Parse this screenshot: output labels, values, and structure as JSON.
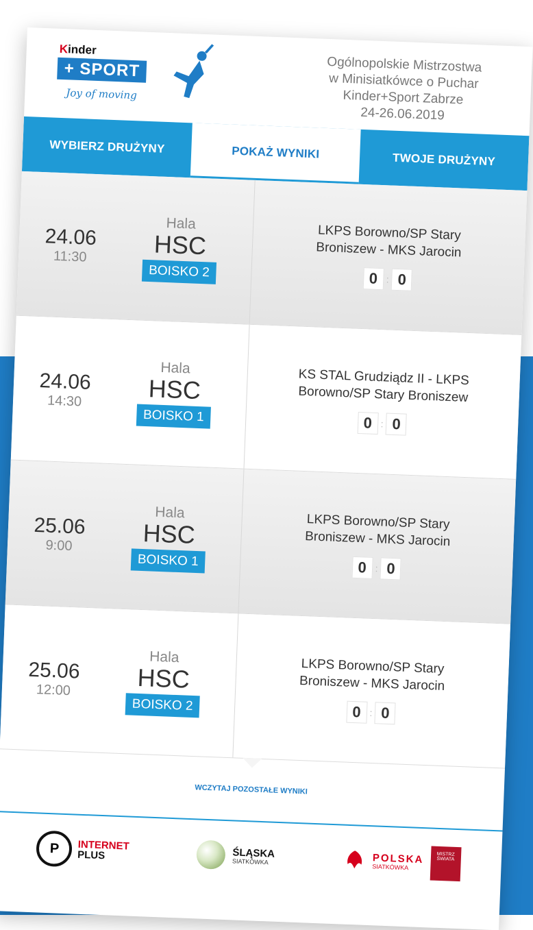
{
  "brand": {
    "kinder_prefix": "K",
    "kinder_rest": "inder",
    "sport": "+ SPORT",
    "tagline": "Joy of moving"
  },
  "event": {
    "line1": "Ogólnopolskie Mistrzostwa",
    "line2": "w Minisiatkówce o Puchar",
    "line3": "Kinder+Sport Zabrze",
    "line4": "24-26.06.2019"
  },
  "tabs": [
    {
      "label": "WYBIERZ DRUŻYNY"
    },
    {
      "label": "POKAŻ WYNIKI"
    },
    {
      "label": "TWOJE DRUŻYNY"
    }
  ],
  "matches": [
    {
      "date": "24.06",
      "time": "11:30",
      "hall_label": "Hala",
      "hall": "HSC",
      "court": "BOISKO 2",
      "teams_line1": "LKPS Borowno/SP Stary",
      "teams_line2": "Broniszew - MKS Jarocin",
      "score_home": "0",
      "score_away": "0"
    },
    {
      "date": "24.06",
      "time": "14:30",
      "hall_label": "Hala",
      "hall": "HSC",
      "court": "BOISKO 1",
      "teams_line1": "KS STAL Grudziądz II - LKPS",
      "teams_line2": "Borowno/SP Stary Broniszew",
      "score_home": "0",
      "score_away": "0"
    },
    {
      "date": "25.06",
      "time": "9:00",
      "hall_label": "Hala",
      "hall": "HSC",
      "court": "BOISKO 1",
      "teams_line1": "LKPS Borowno/SP Stary",
      "teams_line2": "Broniszew - MKS Jarocin",
      "score_home": "0",
      "score_away": "0"
    },
    {
      "date": "25.06",
      "time": "12:00",
      "hall_label": "Hala",
      "hall": "HSC",
      "court": "BOISKO 2",
      "teams_line1": "LKPS Borowno/SP Stary",
      "teams_line2": "Broniszew - MKS Jarocin",
      "score_home": "0",
      "score_away": "0"
    }
  ],
  "load_more": "WCZYTAJ POZOSTAŁE WYNIKI",
  "sponsors": {
    "internet_plus_1": "INTERNET",
    "internet_plus_2": "PLUS",
    "slaska_1": "ŚLĄSKA",
    "slaska_2": "SIATKÓWKA",
    "polska_1": "POLSKA",
    "polska_2": "SIATKÓWKA",
    "champ": "MISTRZ ŚWIATA"
  },
  "colors": {
    "primary": "#1f9ad6",
    "dark_blue": "#1f7dc6",
    "red": "#d6001c"
  }
}
